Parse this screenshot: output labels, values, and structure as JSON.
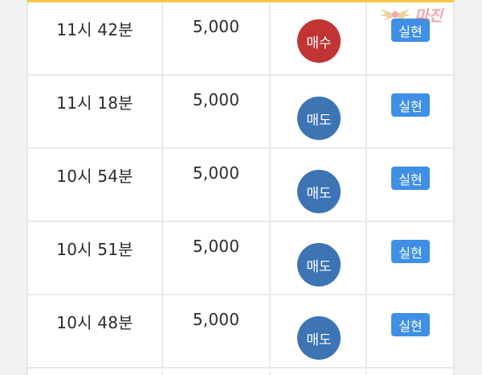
{
  "colors": {
    "buy": "#c03434",
    "sell": "#3c74b4",
    "badge": "#3f8fe5",
    "header_accent": "#f3c64a"
  },
  "watermark": {
    "text": "마진"
  },
  "rows": [
    {
      "time": "11시 42분",
      "amount": "5,000",
      "type": "매수",
      "type_kind": "buy",
      "status": "실현"
    },
    {
      "time": "11시 18분",
      "amount": "5,000",
      "type": "매도",
      "type_kind": "sell",
      "status": "실현"
    },
    {
      "time": "10시 54분",
      "amount": "5,000",
      "type": "매도",
      "type_kind": "sell",
      "status": "실현"
    },
    {
      "time": "10시 51분",
      "amount": "5,000",
      "type": "매도",
      "type_kind": "sell",
      "status": "실현"
    },
    {
      "time": "10시 48분",
      "amount": "5,000",
      "type": "매도",
      "type_kind": "sell",
      "status": "실현"
    }
  ]
}
